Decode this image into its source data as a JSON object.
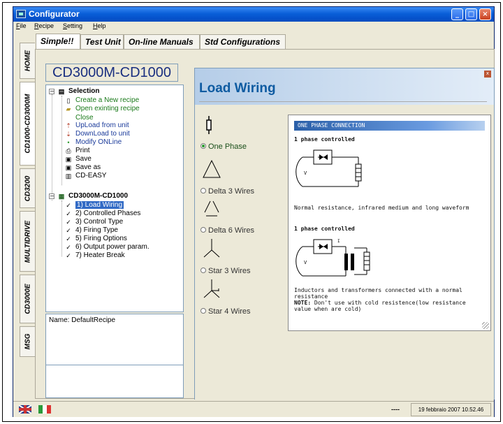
{
  "window": {
    "title": "Configurator"
  },
  "menu": [
    {
      "label": "File",
      "accel": "F",
      "rest": "ile"
    },
    {
      "label": "Recipe",
      "accel": "R",
      "rest": "ecipe"
    },
    {
      "label": "Setting",
      "accel": "S",
      "rest": "etting"
    },
    {
      "label": "Help",
      "accel": "H",
      "rest": "elp"
    }
  ],
  "tabs": [
    "Simple!!",
    "Test Unit",
    "On-line Manuals",
    "Std Configurations"
  ],
  "vertical_tabs": [
    "HOME",
    "CD1000-CD3000M",
    "CD3200",
    "MULTIDRIVE",
    "CD3000E",
    "MSG"
  ],
  "model_title": "CD3000M-CD1000",
  "tree": {
    "root": "Selection",
    "items": [
      "Create a New recipe",
      "Open exinting recipe",
      "Close",
      "UpLoad from unit",
      "DownLoad to unit",
      "Modify ONLine",
      "Print",
      "Save",
      "Save as",
      "CD-EASY"
    ],
    "node": "CD3000M-CD1000",
    "steps": [
      "1) Load Wiring",
      "2) Controlled Phases",
      "3) Control Type",
      "4) Firing Type",
      "5) Firing Options",
      "6) Output power param.",
      "7) Heater Break"
    ]
  },
  "name_box": {
    "label": "Name: DefaultRecipe"
  },
  "panel": {
    "title": "Load Wiring",
    "options": [
      {
        "label": "One Phase",
        "selected": true,
        "icon": "one-phase-icon"
      },
      {
        "label": "Delta 3 Wires",
        "selected": false,
        "icon": "delta-3-wires-icon"
      },
      {
        "label": "Delta 6 Wires",
        "selected": false,
        "icon": "delta-6-wires-icon"
      },
      {
        "label": "Star 3 Wires",
        "selected": false,
        "icon": "star-3-wires-icon"
      },
      {
        "label": "Star 4 Wires",
        "selected": false,
        "icon": "star-4-wires-icon"
      }
    ],
    "info": {
      "header": "ONE PHASE CONNECTION",
      "s1_title": "1 phase controlled",
      "s1_desc": "Normal resistance, infrared medium and long waveform",
      "s2_title": "1 phase controlled",
      "s2_desc": "Inductors and transformers connected with a normal resistance",
      "note_label": "NOTE:",
      "note_text": " Don't use with cold resistence(low resistance value when are cold)"
    }
  },
  "status": {
    "dash": "----",
    "datetime": "19 febbraio 2007 10.52.46"
  },
  "colors": {
    "titlebar": "#0a5fd8",
    "panel_title": "#0e5ba1",
    "selected": "#316ac5",
    "green_item": "#1a7a1a"
  }
}
